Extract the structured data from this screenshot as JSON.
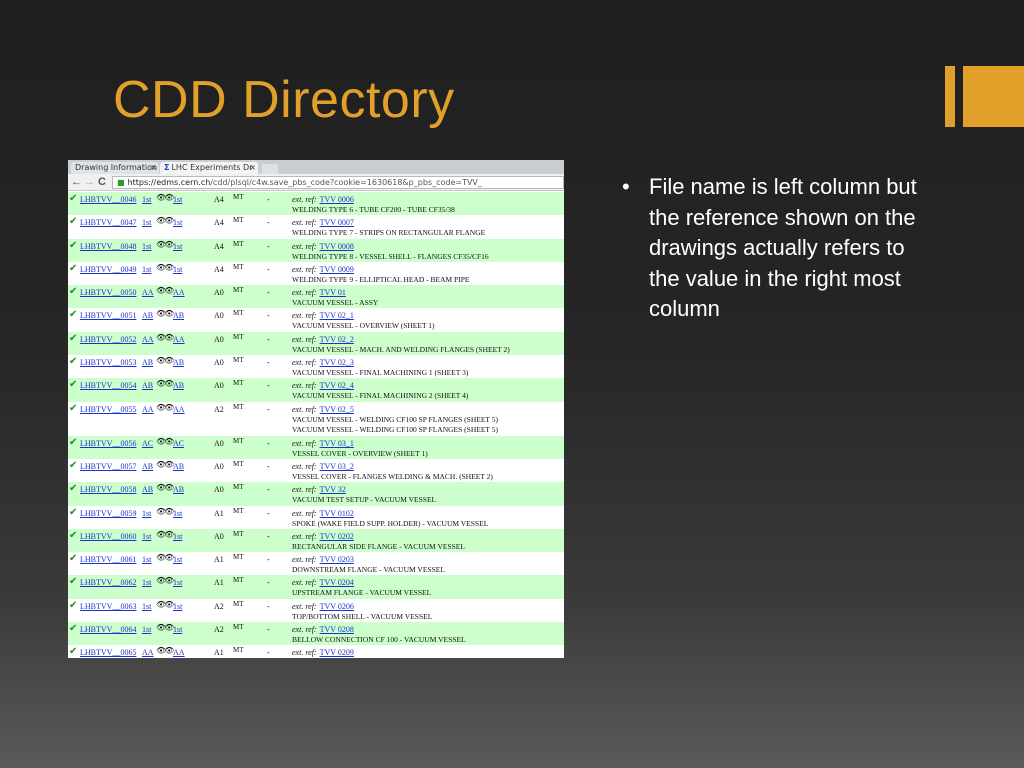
{
  "slide": {
    "title": "CDD Directory",
    "bullet": "File name is left column but the reference shown on the drawings actually refers to the value in the right most column"
  },
  "colors": {
    "accent": "#e0a02a",
    "row_green": "#ccffcc",
    "link": "#1a33cc",
    "check": "#1e8f1e"
  },
  "browser": {
    "tab1": "Drawing Information",
    "tab2_symbol": "Σ",
    "tab2": "LHC Experiments Dr",
    "tab_close": "×",
    "url_host": "https://edms.cern.ch",
    "url_path": "/cdd/plsql/c4w.save_pbs_code?cookie=1630618&p_pbs_code=TVV_",
    "back": "←",
    "forward": "→",
    "reload": "C"
  },
  "table": {
    "ref_prefix": "ext. ref:",
    "rows": [
      {
        "code": "LHBTVV__0046",
        "rev": "1st",
        "rev2": "1st",
        "fmt": "A4",
        "mt": "MT",
        "dash": "-",
        "ref": "TVV 0006",
        "desc": "WELDING TYPE 6 - TUBE CF200 - TUBE CF35/38"
      },
      {
        "code": "LHBTVV__0047",
        "rev": "1st",
        "rev2": "1st",
        "fmt": "A4",
        "mt": "MT",
        "dash": "-",
        "ref": "TVV 0007",
        "desc": "WELDING TYPE 7 - STRIPS ON RECTANGULAR FLANGE"
      },
      {
        "code": "LHBTVV__0048",
        "rev": "1st",
        "rev2": "1st",
        "fmt": "A4",
        "mt": "MT",
        "dash": "-",
        "ref": "TVV 0008",
        "desc": "WELDING TYPE 8 - VESSEL SHELL - FLANGES CF35/CF16"
      },
      {
        "code": "LHBTVV__0049",
        "rev": "1st",
        "rev2": "1st",
        "fmt": "A4",
        "mt": "MT",
        "dash": "-",
        "ref": "TVV 0009",
        "desc": "WELDING TYPE 9 - ELLIPTICAL HEAD - BEAM PIPE"
      },
      {
        "code": "LHBTVV__0050",
        "rev": "AA",
        "rev2": "AA",
        "fmt": "A0",
        "mt": "MT",
        "dash": "-",
        "ref": "TVV 01",
        "desc": "VACUUM VESSEL - ASSY"
      },
      {
        "code": "LHBTVV__0051",
        "rev": "AB",
        "rev2": "AB",
        "fmt": "A0",
        "mt": "MT",
        "dash": "-",
        "ref": "TVV 02_1",
        "desc": "VACUUM VESSEL - OVERVIEW (SHEET 1)"
      },
      {
        "code": "LHBTVV__0052",
        "rev": "AA",
        "rev2": "AA",
        "fmt": "A0",
        "mt": "MT",
        "dash": "-",
        "ref": "TVV 02_2",
        "desc": "VACUUM VESSEL - MACH. AND WELDING FLANGES (SHEET 2)"
      },
      {
        "code": "LHBTVV__0053",
        "rev": "AB",
        "rev2": "AB",
        "fmt": "A0",
        "mt": "MT",
        "dash": "-",
        "ref": "TVV 02_3",
        "desc": "VACUUM VESSEL - FINAL MACHINING 1 (SHEET 3)"
      },
      {
        "code": "LHBTVV__0054",
        "rev": "AB",
        "rev2": "AB",
        "fmt": "A0",
        "mt": "MT",
        "dash": "-",
        "ref": "TVV 02_4",
        "desc": "VACUUM VESSEL - FINAL MACHINING 2 (SHEET 4)"
      },
      {
        "code": "LHBTVV__0055",
        "rev": "AA",
        "rev2": "AA",
        "fmt": "A2",
        "mt": "MT",
        "dash": "-",
        "ref": "TVV 02_5",
        "desc": "VACUUM VESSEL - WELDING CF100 SP FLANGES (SHEET 5)",
        "desc2": "VACUUM VESSEL - WELDING CF100 SP FLANGES (SHEET 5)"
      },
      {
        "code": "LHBTVV__0056",
        "rev": "AC",
        "rev2": "AC",
        "fmt": "A0",
        "mt": "MT",
        "dash": "-",
        "ref": "TVV 03_1",
        "desc": "VESSEL COVER - OVERVIEW (SHEET 1)"
      },
      {
        "code": "LHBTVV__0057",
        "rev": "AB",
        "rev2": "AB",
        "fmt": "A0",
        "mt": "MT",
        "dash": "-",
        "ref": "TVV 03_2",
        "desc": "VESSEL COVER - FLANGES WELDING & MACH. (SHEET 2)"
      },
      {
        "code": "LHBTVV__0058",
        "rev": "AB",
        "rev2": "AB",
        "fmt": "A0",
        "mt": "MT",
        "dash": "-",
        "ref": "TVV 32",
        "desc": "VACUUM TEST SETUP - VACUUM VESSEL"
      },
      {
        "code": "LHBTVV__0059",
        "rev": "1st",
        "rev2": "1st",
        "fmt": "A1",
        "mt": "MT",
        "dash": "-",
        "ref": "TVV 0102",
        "desc": "SPOKE (WAKE FIELD SUPP. HOLDER) - VACUUM VESSEL"
      },
      {
        "code": "LHBTVV__0060",
        "rev": "1st",
        "rev2": "1st",
        "fmt": "A0",
        "mt": "MT",
        "dash": "-",
        "ref": "TVV 0202",
        "desc": "RECTANGULAR SIDE FLANGE - VACUUM VESSEL"
      },
      {
        "code": "LHBTVV__0061",
        "rev": "1st",
        "rev2": "1st",
        "fmt": "A1",
        "mt": "MT",
        "dash": "-",
        "ref": "TVV 0203",
        "desc": "DOWNSTREAM FLANGE - VACUUM VESSEL"
      },
      {
        "code": "LHBTVV__0062",
        "rev": "1st",
        "rev2": "1st",
        "fmt": "A1",
        "mt": "MT",
        "dash": "-",
        "ref": "TVV 0204",
        "desc": "UPSTREAM FLANGE - VACUUM VESSEL"
      },
      {
        "code": "LHBTVV__0063",
        "rev": "1st",
        "rev2": "1st",
        "fmt": "A2",
        "mt": "MT",
        "dash": "-",
        "ref": "TVV 0206",
        "desc": "TOP/BOTTOM SHELL - VACUUM VESSEL"
      },
      {
        "code": "LHBTVV__0064",
        "rev": "1st",
        "rev2": "1st",
        "fmt": "A2",
        "mt": "MT",
        "dash": "-",
        "ref": "TVV 0208",
        "desc": "BELLOW CONNECTION CF 100 - VACUUM VESSEL"
      },
      {
        "code": "LHBTVV__0065",
        "rev": "AA",
        "rev2": "AA",
        "fmt": "A1",
        "mt": "MT",
        "dash": "-",
        "ref": "TVV 0209",
        "desc": ""
      }
    ]
  }
}
